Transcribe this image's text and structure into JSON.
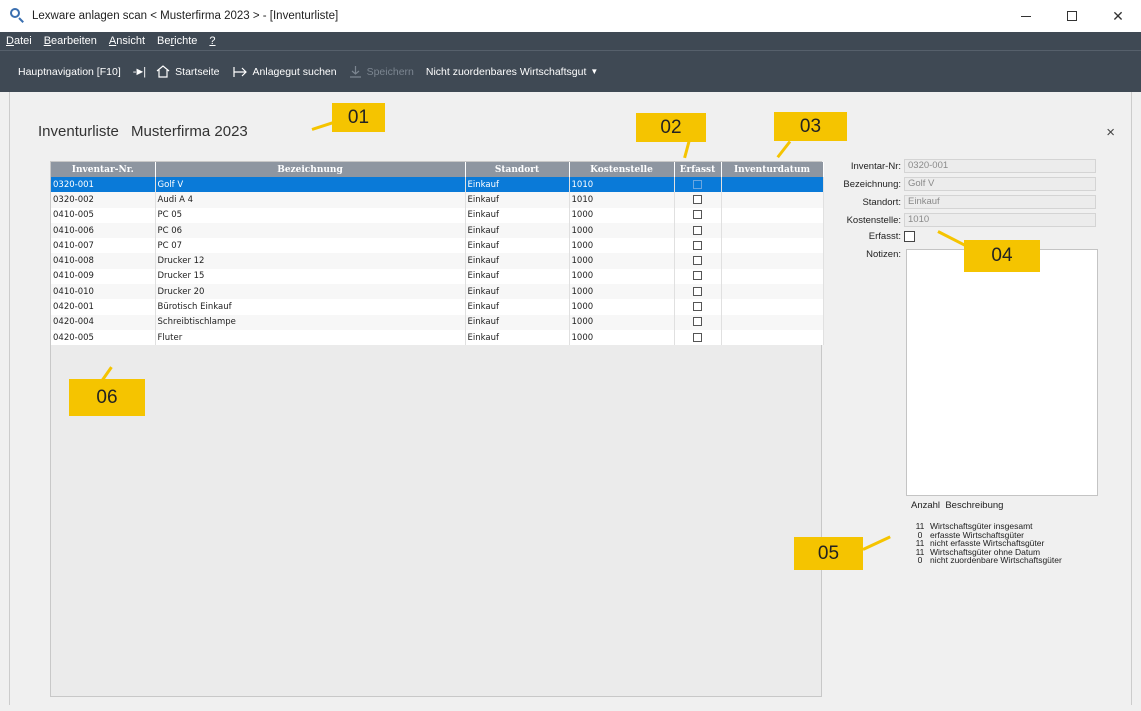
{
  "window": {
    "title": "Lexware anlagen scan < Musterfirma 2023 > - [Inventurliste]",
    "minimize": "",
    "maximize": "",
    "close": "✕"
  },
  "menu": [
    {
      "underline": "D",
      "rest": "atei"
    },
    {
      "underline": "B",
      "rest": "earbeiten"
    },
    {
      "underline": "A",
      "rest": "nsicht"
    },
    {
      "pre": "Be",
      "underline": "r",
      "rest": "ichte"
    },
    {
      "underline": "?",
      "rest": ""
    }
  ],
  "toolbar": {
    "hauptnavigation": "Hauptnavigation [F10]",
    "pin": "-►|",
    "startseite": "Startseite",
    "anlagegut": "Anlagegut suchen",
    "speichern": "Speichern",
    "nicht_zuordenbar": "Nicht zuordenbares Wirtschaftsgut"
  },
  "page": {
    "title": "Inventurliste",
    "company": "Musterfirma 2023",
    "close": "×"
  },
  "table": {
    "columns": [
      "Inventar-Nr.",
      "Bezeichnung",
      "Standort",
      "Kostenstelle",
      "Erfasst",
      "Inventurdatum"
    ],
    "rows": [
      {
        "nr": "0320-001",
        "bez": "Golf V",
        "standort": "Einkauf",
        "kst": "1010",
        "erfasst": false,
        "datum": "",
        "selected": true
      },
      {
        "nr": "0320-002",
        "bez": "Audi A 4",
        "standort": "Einkauf",
        "kst": "1010",
        "erfasst": false,
        "datum": ""
      },
      {
        "nr": "0410-005",
        "bez": "PC 05",
        "standort": "Einkauf",
        "kst": "1000",
        "erfasst": false,
        "datum": ""
      },
      {
        "nr": "0410-006",
        "bez": "PC 06",
        "standort": "Einkauf",
        "kst": "1000",
        "erfasst": false,
        "datum": ""
      },
      {
        "nr": "0410-007",
        "bez": "PC 07",
        "standort": "Einkauf",
        "kst": "1000",
        "erfasst": false,
        "datum": ""
      },
      {
        "nr": "0410-008",
        "bez": "Drucker 12",
        "standort": "Einkauf",
        "kst": "1000",
        "erfasst": false,
        "datum": ""
      },
      {
        "nr": "0410-009",
        "bez": "Drucker 15",
        "standort": "Einkauf",
        "kst": "1000",
        "erfasst": false,
        "datum": ""
      },
      {
        "nr": "0410-010",
        "bez": "Drucker 20",
        "standort": "Einkauf",
        "kst": "1000",
        "erfasst": false,
        "datum": ""
      },
      {
        "nr": "0420-001",
        "bez": "Bürotisch Einkauf",
        "standort": "Einkauf",
        "kst": "1000",
        "erfasst": false,
        "datum": ""
      },
      {
        "nr": "0420-004",
        "bez": "Schreibtischlampe",
        "standort": "Einkauf",
        "kst": "1000",
        "erfasst": false,
        "datum": ""
      },
      {
        "nr": "0420-005",
        "bez": "Fluter",
        "standort": "Einkauf",
        "kst": "1000",
        "erfasst": false,
        "datum": ""
      }
    ]
  },
  "detail": {
    "inventar_nr_label": "Inventar-Nr:",
    "inventar_nr": "0320-001",
    "bezeichnung_label": "Bezeichnung:",
    "bezeichnung": "Golf V",
    "standort_label": "Standort:",
    "standort": "Einkauf",
    "kostenstelle_label": "Kostenstelle:",
    "kostenstelle": "1010",
    "erfasst_label": "Erfasst:",
    "notizen_label": "Notizen:"
  },
  "stats": {
    "head_anzahl": "Anzahl",
    "head_beschreibung": "Beschreibung",
    "rows": [
      {
        "n": "11",
        "text": "Wirtschaftsgüter insgesamt"
      },
      {
        "n": "0",
        "text": "erfasste Wirtschaftsgüter"
      },
      {
        "n": "11",
        "text": "nicht erfasste Wirtschaftsgüter"
      },
      {
        "n": "11",
        "text": "Wirtschaftsgüter ohne Datum"
      },
      {
        "n": "0",
        "text": "nicht zuordenbare Wirtschaftsgüter"
      }
    ]
  },
  "callouts": [
    "01",
    "02",
    "03",
    "04",
    "05",
    "06"
  ],
  "colors": {
    "toolbar_bg": "#3f4954",
    "selection": "#0a7ad8",
    "header_bg": "#8e96a1",
    "callout": "#f5c400"
  },
  "icons": {
    "app": "magnifier-icon",
    "home": "home-icon",
    "search": "arrow-into-icon",
    "save": "save-icon"
  }
}
